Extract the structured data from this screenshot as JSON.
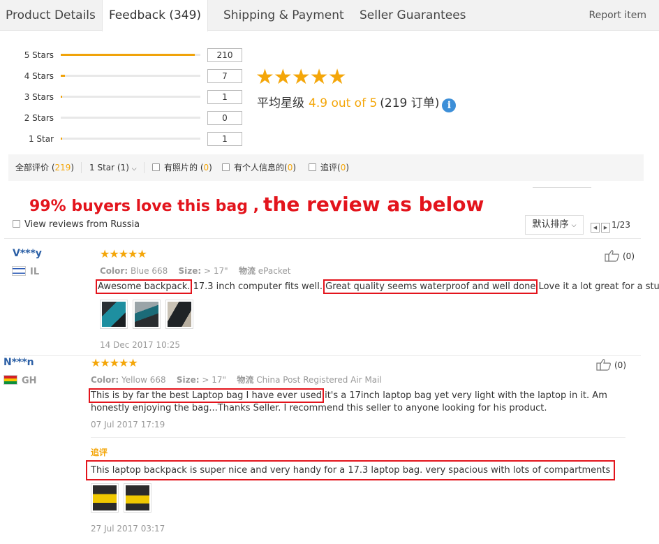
{
  "tabs": [
    {
      "label": "Product Details"
    },
    {
      "label": "Feedback (349)"
    },
    {
      "label": "Shipping & Payment"
    },
    {
      "label": "Seller Guarantees"
    }
  ],
  "report_label": "Report item",
  "histogram": [
    {
      "label": "5 Stars",
      "count": "210",
      "fraction": 0.96
    },
    {
      "label": "4 Stars",
      "count": "7",
      "fraction": 0.03
    },
    {
      "label": "3 Stars",
      "count": "1",
      "fraction": 0.005
    },
    {
      "label": "2 Stars",
      "count": "0",
      "fraction": 0
    },
    {
      "label": "1 Star",
      "count": "1",
      "fraction": 0.005
    }
  ],
  "rating": {
    "stars": "★★★★★",
    "avg_label": "平均星级",
    "avg_score": "4.9 out of 5",
    "orders": "(219 订单)",
    "info_icon": "i"
  },
  "filters": {
    "all_label": "全部评价 (",
    "all_count": "219",
    "all_close": ")",
    "star_select": "1 Star (1)",
    "with_photos": "有照片的 (",
    "with_photos_count": "0",
    "personal": "有个人信息的(",
    "personal_count": "0",
    "followup": "追评(",
    "followup_count": "0",
    "close": ")"
  },
  "promo": {
    "part1": "99% buyers love this bag ,",
    "part2": "the review as below"
  },
  "russia_label": "View reviews from Russia",
  "sort_label": "默认排序",
  "pager": {
    "prev": "◀",
    "next": "▶",
    "text": "1/23"
  },
  "reviews": [
    {
      "name": "V***y",
      "country": "IL",
      "stars": "★★★★★",
      "color_label": "Color:",
      "color": "Blue 668",
      "size_label": "Size:",
      "size": "> 17\"",
      "ship_label": "物流",
      "ship": "ePacket",
      "text_hl1": "Awesome backpack.",
      "text_mid": " 17.3 inch computer fits well. ",
      "text_hl2": "Great quality seems waterproof and well done",
      "text_end": " Love it a lot great for a student",
      "date": "14 Dec 2017 10:25",
      "helpful": "(0)"
    },
    {
      "name": "N***n",
      "country": "GH",
      "stars": "★★★★★",
      "color_label": "Color:",
      "color": "Yellow 668",
      "size_label": "Size:",
      "size": "> 17\"",
      "ship_label": "物流",
      "ship": "China Post Registered Air Mail",
      "text_hl1": "This is by far the best Laptop bag I have ever used",
      "text_end": " it's a 17inch laptop bag yet very light with the laptop in it. Am honestly enjoying the bag...Thanks Seller. I recommend this seller to anyone looking for his product.",
      "date": "07 Jul 2017 17:19",
      "helpful": "(0)",
      "additional_label": "追评",
      "additional_text": "This laptop backpack is super nice and very handy for a 17.3 laptop bag. very spacious with lots of compartments",
      "additional_date": "27 Jul 2017 03:17"
    }
  ],
  "colors": {
    "accent": "#f4a609",
    "link": "#2b5fa5",
    "highlight": "#e3141c"
  }
}
